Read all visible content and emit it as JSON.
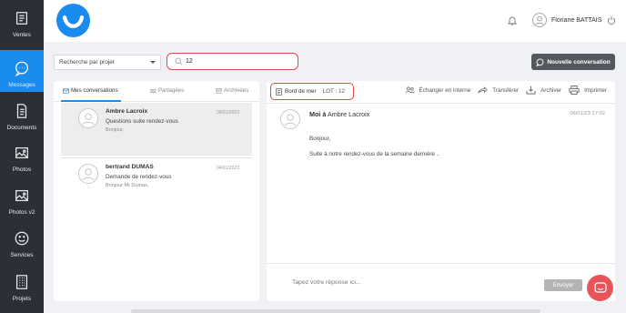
{
  "sidebar": {
    "items": [
      {
        "label": "Ventes",
        "icon": "storefront-icon"
      },
      {
        "label": "Messages",
        "icon": "chat-bubble-icon"
      },
      {
        "label": "Documents",
        "icon": "document-icon"
      },
      {
        "label": "Photos",
        "icon": "image-icon"
      },
      {
        "label": "Photos v2",
        "icon": "image-icon"
      },
      {
        "label": "Services",
        "icon": "smiley-icon"
      },
      {
        "label": "Projets",
        "icon": "building-icon"
      }
    ]
  },
  "header": {
    "user_name": "Floriane BATTAIS"
  },
  "toolbar": {
    "project_select": "Recherche par projet",
    "search_value": "12",
    "new_conversation": "Nouvelle conversation"
  },
  "tabs": {
    "mine": "Mes conversations",
    "shared": "Partagées",
    "archived": "Archivées"
  },
  "conversations": [
    {
      "name": "Ambre Lacroix",
      "subject": "Questions suite rendez-vous",
      "preview": "Bonjour,",
      "date": "06/01/2023"
    },
    {
      "name": "bertrand DUMAS",
      "subject": "Demande de rendez-vous",
      "preview": "Bonjour Mr Dumas,",
      "date": "04/01/2023"
    }
  ],
  "conversation": {
    "project": "Bord de mer",
    "lot": "LOT : 12",
    "actions": {
      "exchange": "Échanger en interne",
      "transfer": "Transférer",
      "archive": "Archiver",
      "print": "Imprimer"
    }
  },
  "message": {
    "from": "Moi",
    "to_prefix": "à",
    "to": "Ambre Lacroix",
    "date": "06/01/23 17:02",
    "lines": [
      "Bonjour,",
      "Suite à notre rendez-vous de la semaine dernière .."
    ]
  },
  "compose": {
    "placeholder": "Tapez votre réponse ici...",
    "send": "Envoyer"
  },
  "colors": {
    "accent": "#1a8cf0",
    "sidebar_bg": "#2d2f38",
    "highlight": "#e14a45",
    "chat_fab": "#e9545b"
  }
}
